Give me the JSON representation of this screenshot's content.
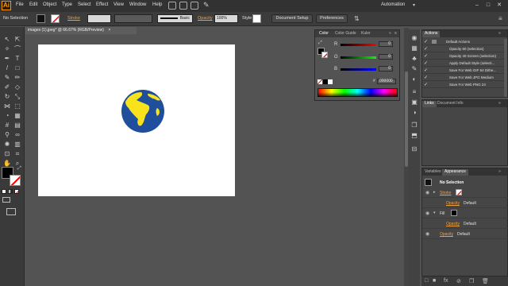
{
  "app": {
    "logo": "Ai",
    "menu": [
      "File",
      "Edit",
      "Object",
      "Type",
      "Select",
      "Effect",
      "View",
      "Window",
      "Help"
    ],
    "workspace": "Automation",
    "window_controls": [
      "–",
      "□",
      "✕"
    ]
  },
  "controlbar": {
    "selection": "No Selection",
    "stroke_label": "Stroke",
    "brush": "Basic",
    "opacity_label": "Opacity",
    "opacity_value": "100%",
    "style_label": "Style",
    "document_setup": "Document Setup",
    "preferences": "Preferences"
  },
  "document": {
    "tab_title": "images (1).jpeg* @ 66.67% (RGB/Preview)",
    "close": "×"
  },
  "color_panel": {
    "tabs": [
      "Color",
      "Color Guide",
      "Kuler"
    ],
    "channels": [
      {
        "label": "R",
        "value": "0"
      },
      {
        "label": "G",
        "value": "0"
      },
      {
        "label": "B",
        "value": "0"
      }
    ],
    "hex_symbol": "#",
    "hex_value": "000000"
  },
  "actions_panel": {
    "tabs": [
      "Actions"
    ],
    "items": [
      {
        "label": "Default Actions"
      },
      {
        "label": "Opacity 60 (selection)"
      },
      {
        "label": "Opacity 40 Screen (selection)"
      },
      {
        "label": "Apply Default Style (selecti..."
      },
      {
        "label": "Save For Web GIF 64 Dithe..."
      },
      {
        "label": "Save For Web JPG Medium"
      },
      {
        "label": "Save For Web PNG 24"
      }
    ]
  },
  "links_panel": {
    "tabs": [
      "Links",
      "Document Info"
    ]
  },
  "appearance_panel": {
    "tabs": [
      "Variables",
      "Appearance"
    ],
    "title": "No Selection",
    "rows": [
      {
        "label": "Stroke",
        "value": ""
      },
      {
        "label": "Opacity",
        "value": "Default"
      },
      {
        "label": "Fill",
        "value": ""
      },
      {
        "label": "Opacity",
        "value": "Default"
      },
      {
        "label": "Opacity",
        "value": "Default"
      }
    ]
  },
  "colors": {
    "menubar": "#323232",
    "control": "#3c3c3c",
    "canvas": "#535353",
    "accent": "#ff9a00",
    "globe_ocean": "#1f4e9c",
    "globe_land": "#f7e21c"
  }
}
